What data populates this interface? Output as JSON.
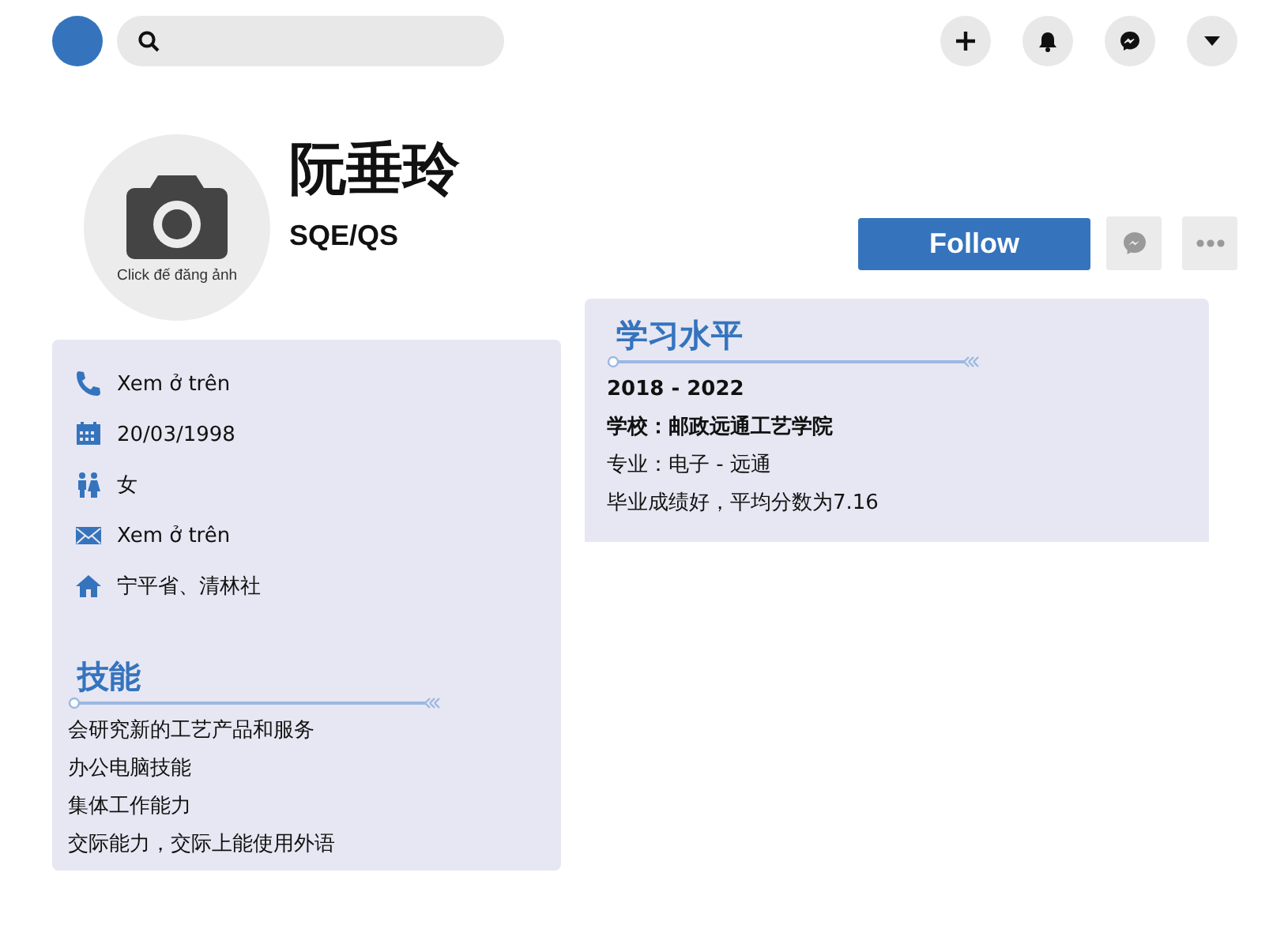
{
  "topbar": {
    "actions": [
      {
        "kind": "plus"
      },
      {
        "kind": "bell"
      },
      {
        "kind": "messenger"
      },
      {
        "kind": "caret"
      }
    ]
  },
  "profile": {
    "avatar_caption": "Click đế đăng ảnh",
    "name": "阮垂玲",
    "position": "SQE/QS"
  },
  "actions": {
    "follow": "Follow"
  },
  "contact": [
    {
      "kind": "phone",
      "text": "Xem ở trên"
    },
    {
      "kind": "calendar",
      "text": "20/03/1998"
    },
    {
      "kind": "gender",
      "text": "女"
    },
    {
      "kind": "mail",
      "text": "Xem ở trên"
    },
    {
      "kind": "home",
      "text": "宁平省、清林社"
    }
  ],
  "skills": {
    "title": "技能",
    "items": [
      "会研究新的工艺产品和服务",
      "办公电脑技能",
      "集体工作能力",
      "交际能力，交际上能使用外语"
    ]
  },
  "education": {
    "title": "学习水平",
    "period": "2018 - 2022",
    "school": "学校：邮政远通工艺学院",
    "major": "专业：电子 - 远通",
    "note": "毕业成绩好，平均分数为7.16"
  }
}
